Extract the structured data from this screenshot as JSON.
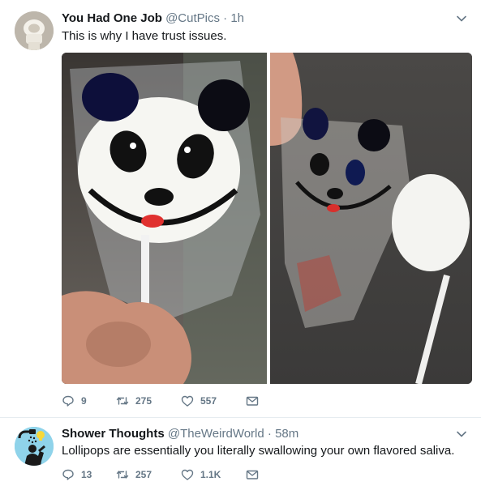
{
  "tweets": [
    {
      "name": "You Had One Job",
      "handle": "@CutPics",
      "separator": "·",
      "time": "1h",
      "text": "This is why I have trust issues.",
      "replies": "9",
      "retweets": "275",
      "likes": "557"
    },
    {
      "name": "Shower Thoughts",
      "handle": "@TheWeirdWorld",
      "separator": "·",
      "time": "58m",
      "text": "Lollipops are essentially you literally swallowing your own flavored saliva.",
      "replies": "13",
      "retweets": "257",
      "likes": "1.1K"
    }
  ],
  "colors": {
    "text": "#14171a",
    "secondary": "#657786",
    "border": "#e6ecf0"
  },
  "icons": [
    "reply-icon",
    "retweet-icon",
    "like-icon",
    "message-icon",
    "chevron-down-icon"
  ]
}
